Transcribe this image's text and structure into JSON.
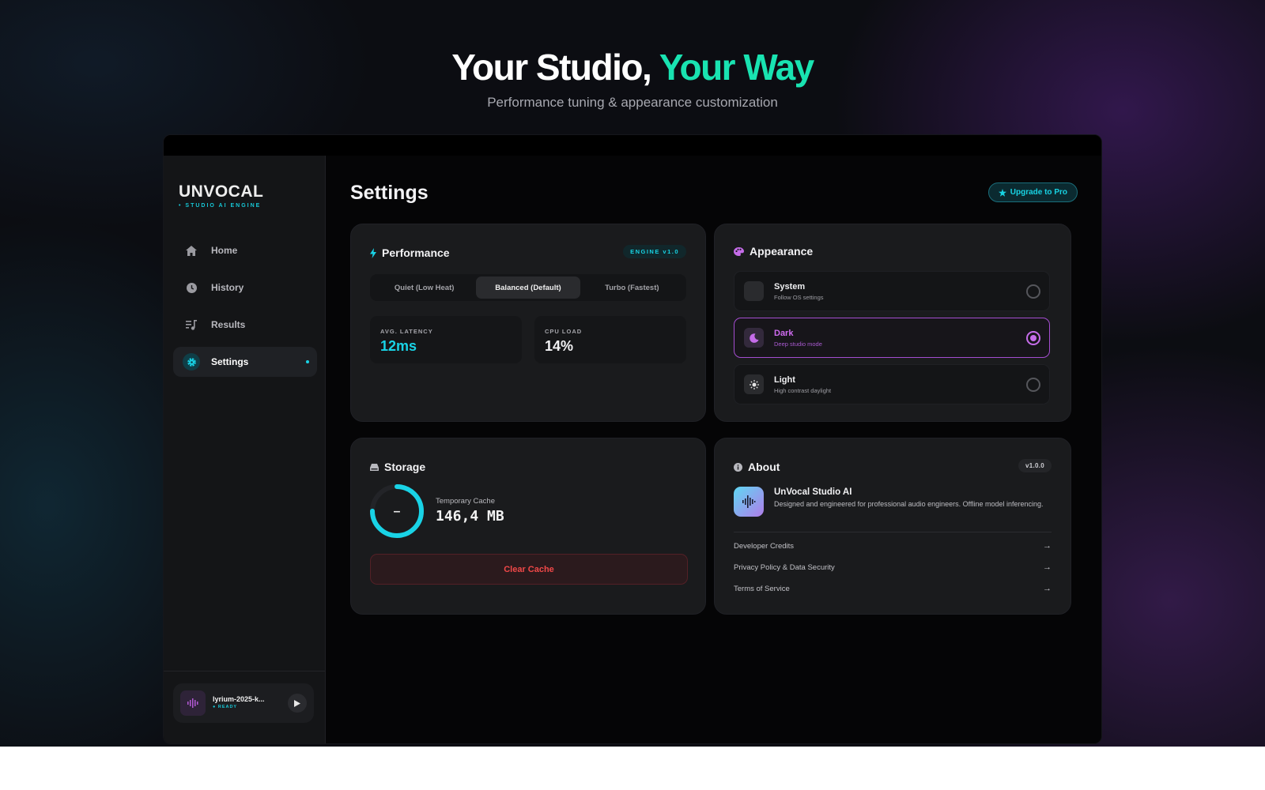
{
  "hero": {
    "title_main": "Your Studio,",
    "title_accent": "Your Way",
    "subtitle": "Performance tuning & appearance customization"
  },
  "sidebar": {
    "logo": "UNVOCAL",
    "logo_sub": "• STUDIO AI ENGINE",
    "items": [
      {
        "label": "Home",
        "icon": "home-icon",
        "active": false
      },
      {
        "label": "History",
        "icon": "clock-icon",
        "active": false
      },
      {
        "label": "Results",
        "icon": "music-list-icon",
        "active": false
      },
      {
        "label": "Settings",
        "icon": "gear-icon",
        "active": true
      }
    ],
    "player": {
      "name": "lyrium-2025-k...",
      "status": "● READY"
    }
  },
  "main": {
    "title": "Settings",
    "upgrade_label": "Upgrade to Pro"
  },
  "performance": {
    "title": "Performance",
    "badge": "ENGINE v1.0",
    "modes": [
      "Quiet (Low Heat)",
      "Balanced (Default)",
      "Turbo (Fastest)"
    ],
    "selected_mode": "Balanced (Default)",
    "stats": [
      {
        "label": "AVG. LATENCY",
        "value": "12ms",
        "color": "#19d3e6"
      },
      {
        "label": "CPU LOAD",
        "value": "14%",
        "color": "#f2f2f4"
      }
    ]
  },
  "appearance": {
    "title": "Appearance",
    "options": [
      {
        "name": "System",
        "desc": "Follow OS settings",
        "icon": "monitor-icon",
        "selected": false
      },
      {
        "name": "Dark",
        "desc": "Deep studio mode",
        "icon": "moon-icon",
        "selected": true
      },
      {
        "name": "Light",
        "desc": "High contrast daylight",
        "icon": "sun-icon",
        "selected": false
      }
    ]
  },
  "storage": {
    "title": "Storage",
    "ring_symbol": "–",
    "cache_label": "Temporary Cache",
    "cache_value": "146,4 MB",
    "clear_label": "Clear Cache"
  },
  "about": {
    "title": "About",
    "version": "v1.0.0",
    "app_name": "UnVocal Studio AI",
    "description": "Designed and engineered for professional audio engineers. Offline model inferencing.",
    "links": [
      "Developer Credits",
      "Privacy Policy & Data Security",
      "Terms of Service"
    ]
  },
  "colors": {
    "accent_cyan": "#19d3e6",
    "accent_green": "#19e3b1",
    "accent_purple": "#c56ce9",
    "danger": "#f04848"
  }
}
